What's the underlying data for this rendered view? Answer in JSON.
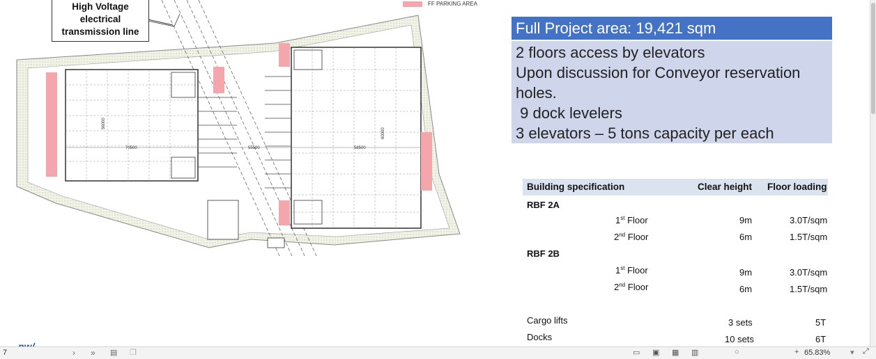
{
  "legend": {
    "parking_label": "FF PARKING AREA",
    "parking_color": "#f3a7ad"
  },
  "callout": {
    "label": "High Voltage\nelectrical\ntransmission line"
  },
  "plan_dims": {
    "left_width": "70500",
    "middle_width": "55500",
    "right_width": "58500",
    "left_depth": "56000",
    "right_depth": "60000"
  },
  "info": {
    "title": "Full Project area: 19,421 sqm",
    "title_color": "#4472c4",
    "lines": [
      "2 floors access by elevators",
      "Upon discussion for Conveyor reservation",
      "holes.",
      " 9 dock levelers",
      "3 elevators – 5 tons capacity per each"
    ],
    "body_color": "#cfd5ea"
  },
  "spec": {
    "headers": {
      "spec": "Building specification",
      "clear_height": "Clear height",
      "floor_loading": "Floor loading"
    },
    "rbf2a": {
      "name": "RBF 2A",
      "f1": {
        "num": "1",
        "sup": "st",
        "label": " Floor",
        "height": "9m",
        "load": "3.0T/sqm"
      },
      "f2": {
        "num": "2",
        "sup": "nd",
        "label": " Floor",
        "height": "6m",
        "load": "1.5T/sqm"
      }
    },
    "rbf2b": {
      "name": "RBF 2B",
      "f1": {
        "num": "1",
        "sup": "st",
        "label": " Floor",
        "height": "9m",
        "load": "3.0T/sqm"
      },
      "f2": {
        "num": "2",
        "sup": "nd",
        "label": " Floor",
        "height": "6m",
        "load": "1.5T/sqm"
      }
    },
    "cargo": {
      "label": "Cargo lifts",
      "qty": "3 sets",
      "value": "5T"
    },
    "docks": {
      "label": "Docks",
      "qty": "10 sets",
      "value": "6T"
    }
  },
  "statusbar": {
    "page": "7",
    "zoom": "65.83%"
  }
}
